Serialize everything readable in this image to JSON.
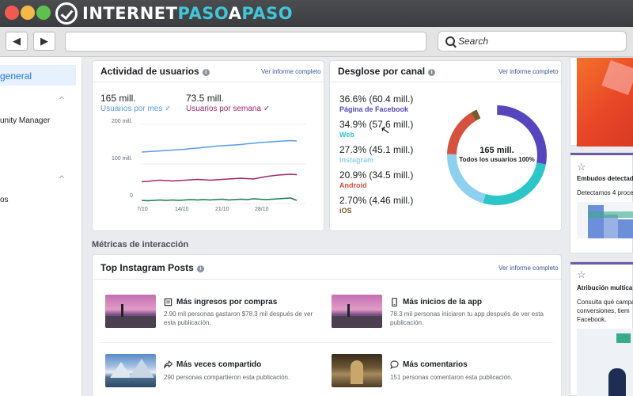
{
  "brand": {
    "part1": "INTERNET",
    "part2": "PASO",
    "part3": "A",
    "part4": "PASO"
  },
  "toolbar": {
    "search_placeholder": "Search",
    "back_label": "◀",
    "forward_label": "▶"
  },
  "sidebar": {
    "items": [
      {
        "label": "general",
        "active": true
      },
      {
        "label": "unity Manager"
      },
      {
        "label": "os"
      }
    ]
  },
  "activity": {
    "title": "Actividad de usuarios",
    "report_link": "Ver informe completo",
    "metrics": [
      {
        "value": "165 mill.",
        "label": "Usuarios por mes ✓",
        "color": "#5b9be8"
      },
      {
        "value": "73.5 mill.",
        "label": "Usuarios por semana ✓",
        "color": "#a0276b"
      }
    ],
    "y_ticks": [
      "200 mill.",
      "100 mill.",
      "0"
    ],
    "x_ticks": [
      "7/10",
      "14/10",
      "21/10",
      "28/10"
    ]
  },
  "chart_data": {
    "type": "line",
    "x": [
      "7/10",
      "8/10",
      "9/10",
      "10/10",
      "11/10",
      "12/10",
      "13/10",
      "14/10",
      "15/10",
      "16/10",
      "17/10",
      "18/10",
      "19/10",
      "20/10",
      "21/10",
      "22/10",
      "23/10",
      "24/10",
      "25/10",
      "26/10",
      "27/10",
      "28/10",
      "29/10",
      "30/10",
      "31/10",
      "1/11"
    ],
    "ylim": [
      0,
      200
    ],
    "y_ticks": [
      "200 mill.",
      "100 mill.",
      "0"
    ],
    "series": [
      {
        "name": "Usuarios por mes",
        "color": "#5b9be8",
        "values": [
          130,
          131,
          132,
          133,
          134,
          135,
          136,
          137,
          139,
          140,
          142,
          143,
          145,
          146,
          147,
          148,
          149,
          151,
          152,
          154,
          155,
          156,
          157,
          158,
          159,
          158
        ]
      },
      {
        "name": "Usuarios por semana",
        "color": "#a0276b",
        "values": [
          55,
          56,
          58,
          59,
          58,
          57,
          58,
          59,
          60,
          61,
          60,
          59,
          60,
          61,
          62,
          63,
          64,
          63,
          62,
          65,
          68,
          70,
          72,
          73,
          74,
          73
        ]
      },
      {
        "color": "#1b7a4e",
        "values": [
          8,
          7,
          8,
          9,
          8,
          9,
          8,
          9,
          10,
          9,
          10,
          9,
          10,
          11,
          9,
          10,
          11,
          10,
          12,
          11,
          10,
          11,
          12,
          13,
          14,
          8
        ]
      }
    ]
  },
  "channels": {
    "title": "Desglose por canal",
    "report_link": "Ver informe completo",
    "items": [
      {
        "value": "36.6% (60.4 mill.)",
        "name": "Página de Facebook",
        "color": "#5646bd",
        "share": 36.6
      },
      {
        "value": "34.9% (57.6 mill.)",
        "name": "Web",
        "color": "#2cc6c9",
        "share": 34.9
      },
      {
        "value": "27.3% (45.1 mill.)",
        "name": "Instagram",
        "color": "#8ed0f0",
        "share": 27.3
      },
      {
        "value": "20.9% (34.5 mill.)",
        "name": "Android",
        "color": "#d5523f",
        "share": 20.9
      },
      {
        "value": "2.70% (4.46 mill.)",
        "name": "iOS",
        "color": "#7a5b2c",
        "share": 2.7
      }
    ],
    "center_value": "165 mill.",
    "center_label": "Todos los usuarios 100%"
  },
  "interaction_section": {
    "title": "Métricas de interacción"
  },
  "posts": {
    "title": "Top Instagram Posts",
    "report_link": "Ver informe completo",
    "items": [
      {
        "title": "Más ingresos por compras",
        "desc": "2.90 mil personas gastaron $78.3 mil después de ver esta publicación.",
        "icon": "receipt-icon"
      },
      {
        "title": "Más inicios de la app",
        "desc": "78.3 mil personas iniciaron tu app después de ver esta publicación.",
        "icon": "phone-icon"
      },
      {
        "title": "Más veces compartido",
        "desc": "290 personas compartieron esta publicación.",
        "icon": "share-icon"
      },
      {
        "title": "Más comentarios",
        "desc": "151 personas comentaron esta publicación.",
        "icon": "comment-icon"
      }
    ]
  },
  "right": {
    "funnels_title": "Embudos detectad",
    "funnels_desc": "Detectamos 4 proce",
    "attribution_title": "Atribución multica",
    "attribution_desc": [
      "Consulta qué campa",
      "conversiones, tiem",
      "Facebook."
    ]
  }
}
